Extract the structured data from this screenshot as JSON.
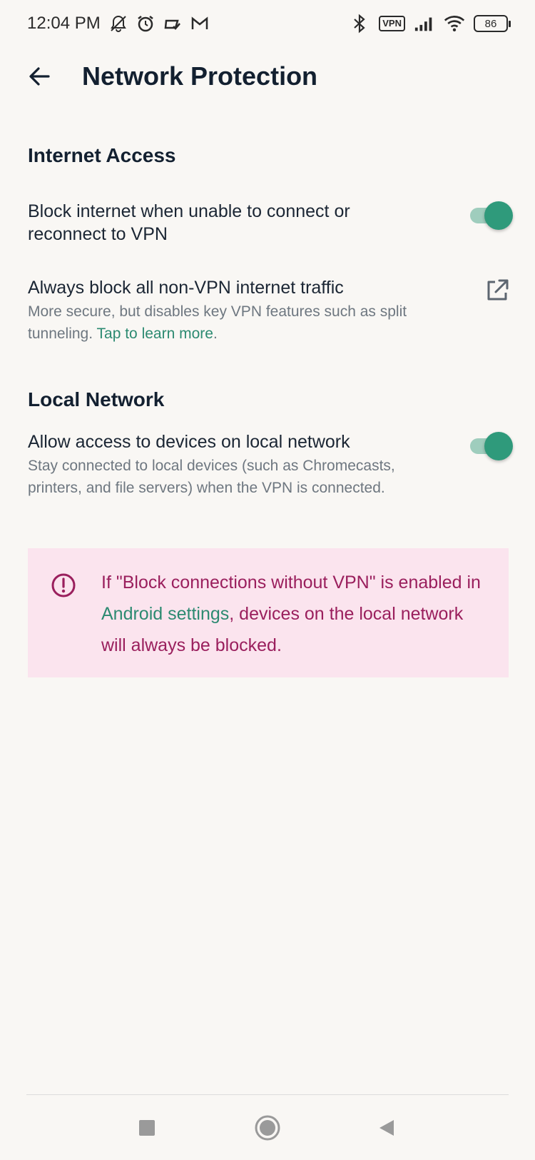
{
  "status_bar": {
    "time": "12:04 PM",
    "left_icons": [
      "muted-notifications-icon",
      "alarm-icon",
      "app-notification-icon",
      "gmail-icon"
    ],
    "right_icons": [
      "bluetooth-icon",
      "vpn-icon",
      "signal-icon",
      "wifi-icon",
      "battery-icon"
    ],
    "vpn_label": "VPN",
    "battery_level": "86"
  },
  "app_bar": {
    "title": "Network Protection",
    "back_icon": "arrow-left-icon"
  },
  "sections": {
    "internet_access": {
      "title": "Internet Access",
      "block_on_disconnect": {
        "title": "Block internet when unable to connect or reconnect to VPN",
        "enabled": true
      },
      "always_block": {
        "title": "Always block all non-VPN internet traffic",
        "desc_prefix": "More secure, but disables key VPN features such as split tunneling. ",
        "desc_link": "Tap to learn more",
        "desc_suffix": ".",
        "icon": "external-link-icon"
      }
    },
    "local_network": {
      "title": "Local Network",
      "allow_local": {
        "title": "Allow access to devices on local network",
        "desc": "Stay connected to local devices (such as Chromecasts, printers, and file servers) when the VPN is connected.",
        "enabled": true
      }
    }
  },
  "warning": {
    "icon": "alert-circle-icon",
    "text_prefix": "If \"Block connections without VPN\" is enabled in ",
    "link": "Android settings",
    "text_suffix": ", devices on the local network will always be blocked."
  },
  "nav_bar": {
    "recents_icon": "square-icon",
    "home_icon": "circle-icon",
    "back_icon": "triangle-back-icon"
  },
  "colors": {
    "background": "#f9f7f4",
    "accent": "#2f9a7b",
    "warning_bg": "#fbe4ee",
    "warning_text": "#9a1f5d"
  }
}
